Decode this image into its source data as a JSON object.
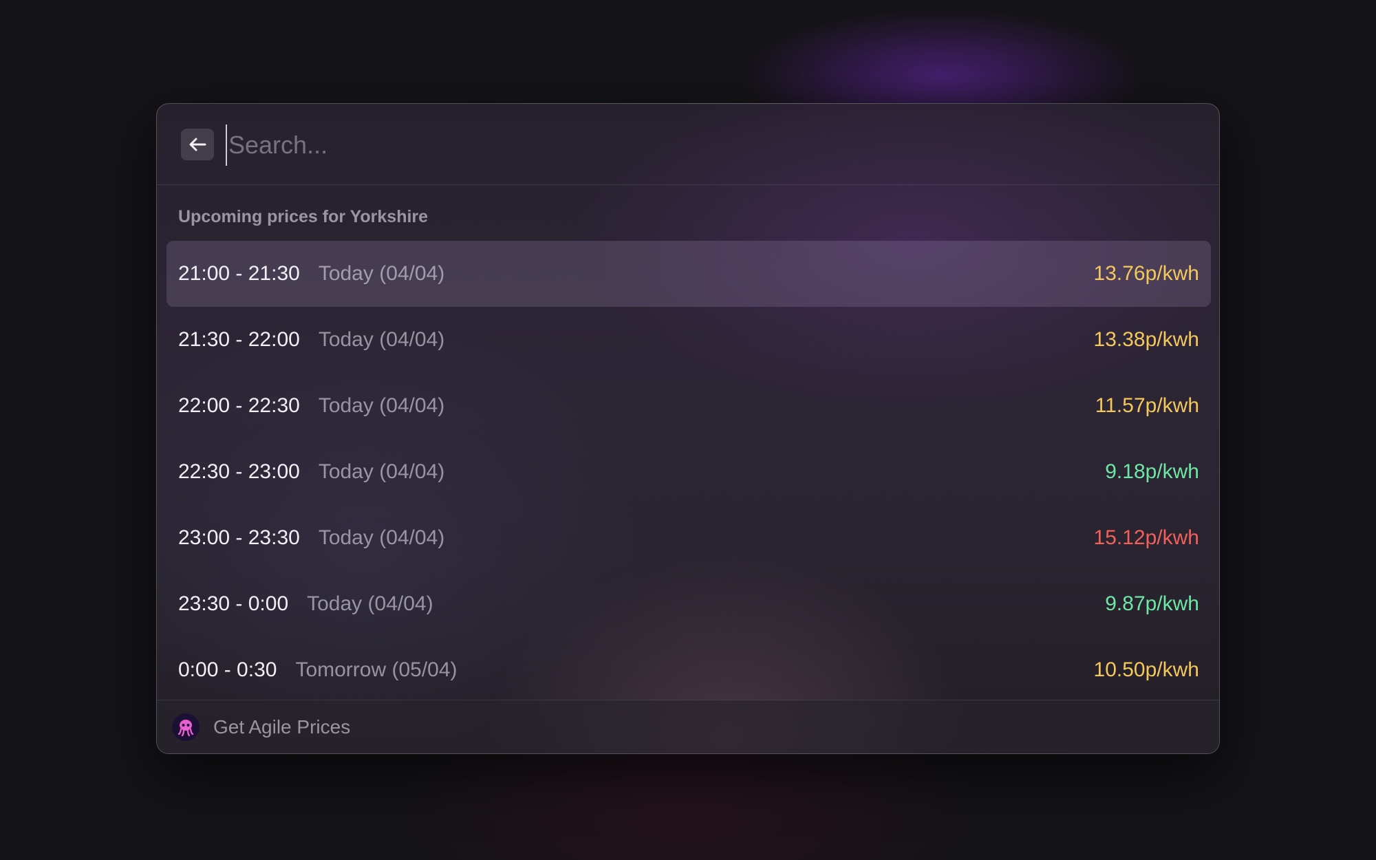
{
  "search": {
    "placeholder": "Search...",
    "back_icon": "arrow-left-icon"
  },
  "section_title": "Upcoming prices for Yorkshire",
  "rows": [
    {
      "time": "21:00 - 21:30",
      "date": "Today (04/04)",
      "price": "13.76p/kwh",
      "color": "#f5c85c",
      "selected": true
    },
    {
      "time": "21:30 - 22:00",
      "date": "Today (04/04)",
      "price": "13.38p/kwh",
      "color": "#f5c85c",
      "selected": false
    },
    {
      "time": "22:00 - 22:30",
      "date": "Today (04/04)",
      "price": "11.57p/kwh",
      "color": "#f5c85c",
      "selected": false
    },
    {
      "time": "22:30 - 23:00",
      "date": "Today (04/04)",
      "price": "9.18p/kwh",
      "color": "#6ee7a4",
      "selected": false
    },
    {
      "time": "23:00 - 23:30",
      "date": "Today (04/04)",
      "price": "15.12p/kwh",
      "color": "#f2605a",
      "selected": false
    },
    {
      "time": "23:30 - 0:00",
      "date": "Today (04/04)",
      "price": "9.87p/kwh",
      "color": "#6ee7a4",
      "selected": false
    },
    {
      "time": "0:00 - 0:30",
      "date": "Tomorrow (05/04)",
      "price": "10.50p/kwh",
      "color": "#f5c85c",
      "selected": false
    }
  ],
  "footer": {
    "icon": "octopus-icon",
    "label": "Get Agile Prices"
  }
}
